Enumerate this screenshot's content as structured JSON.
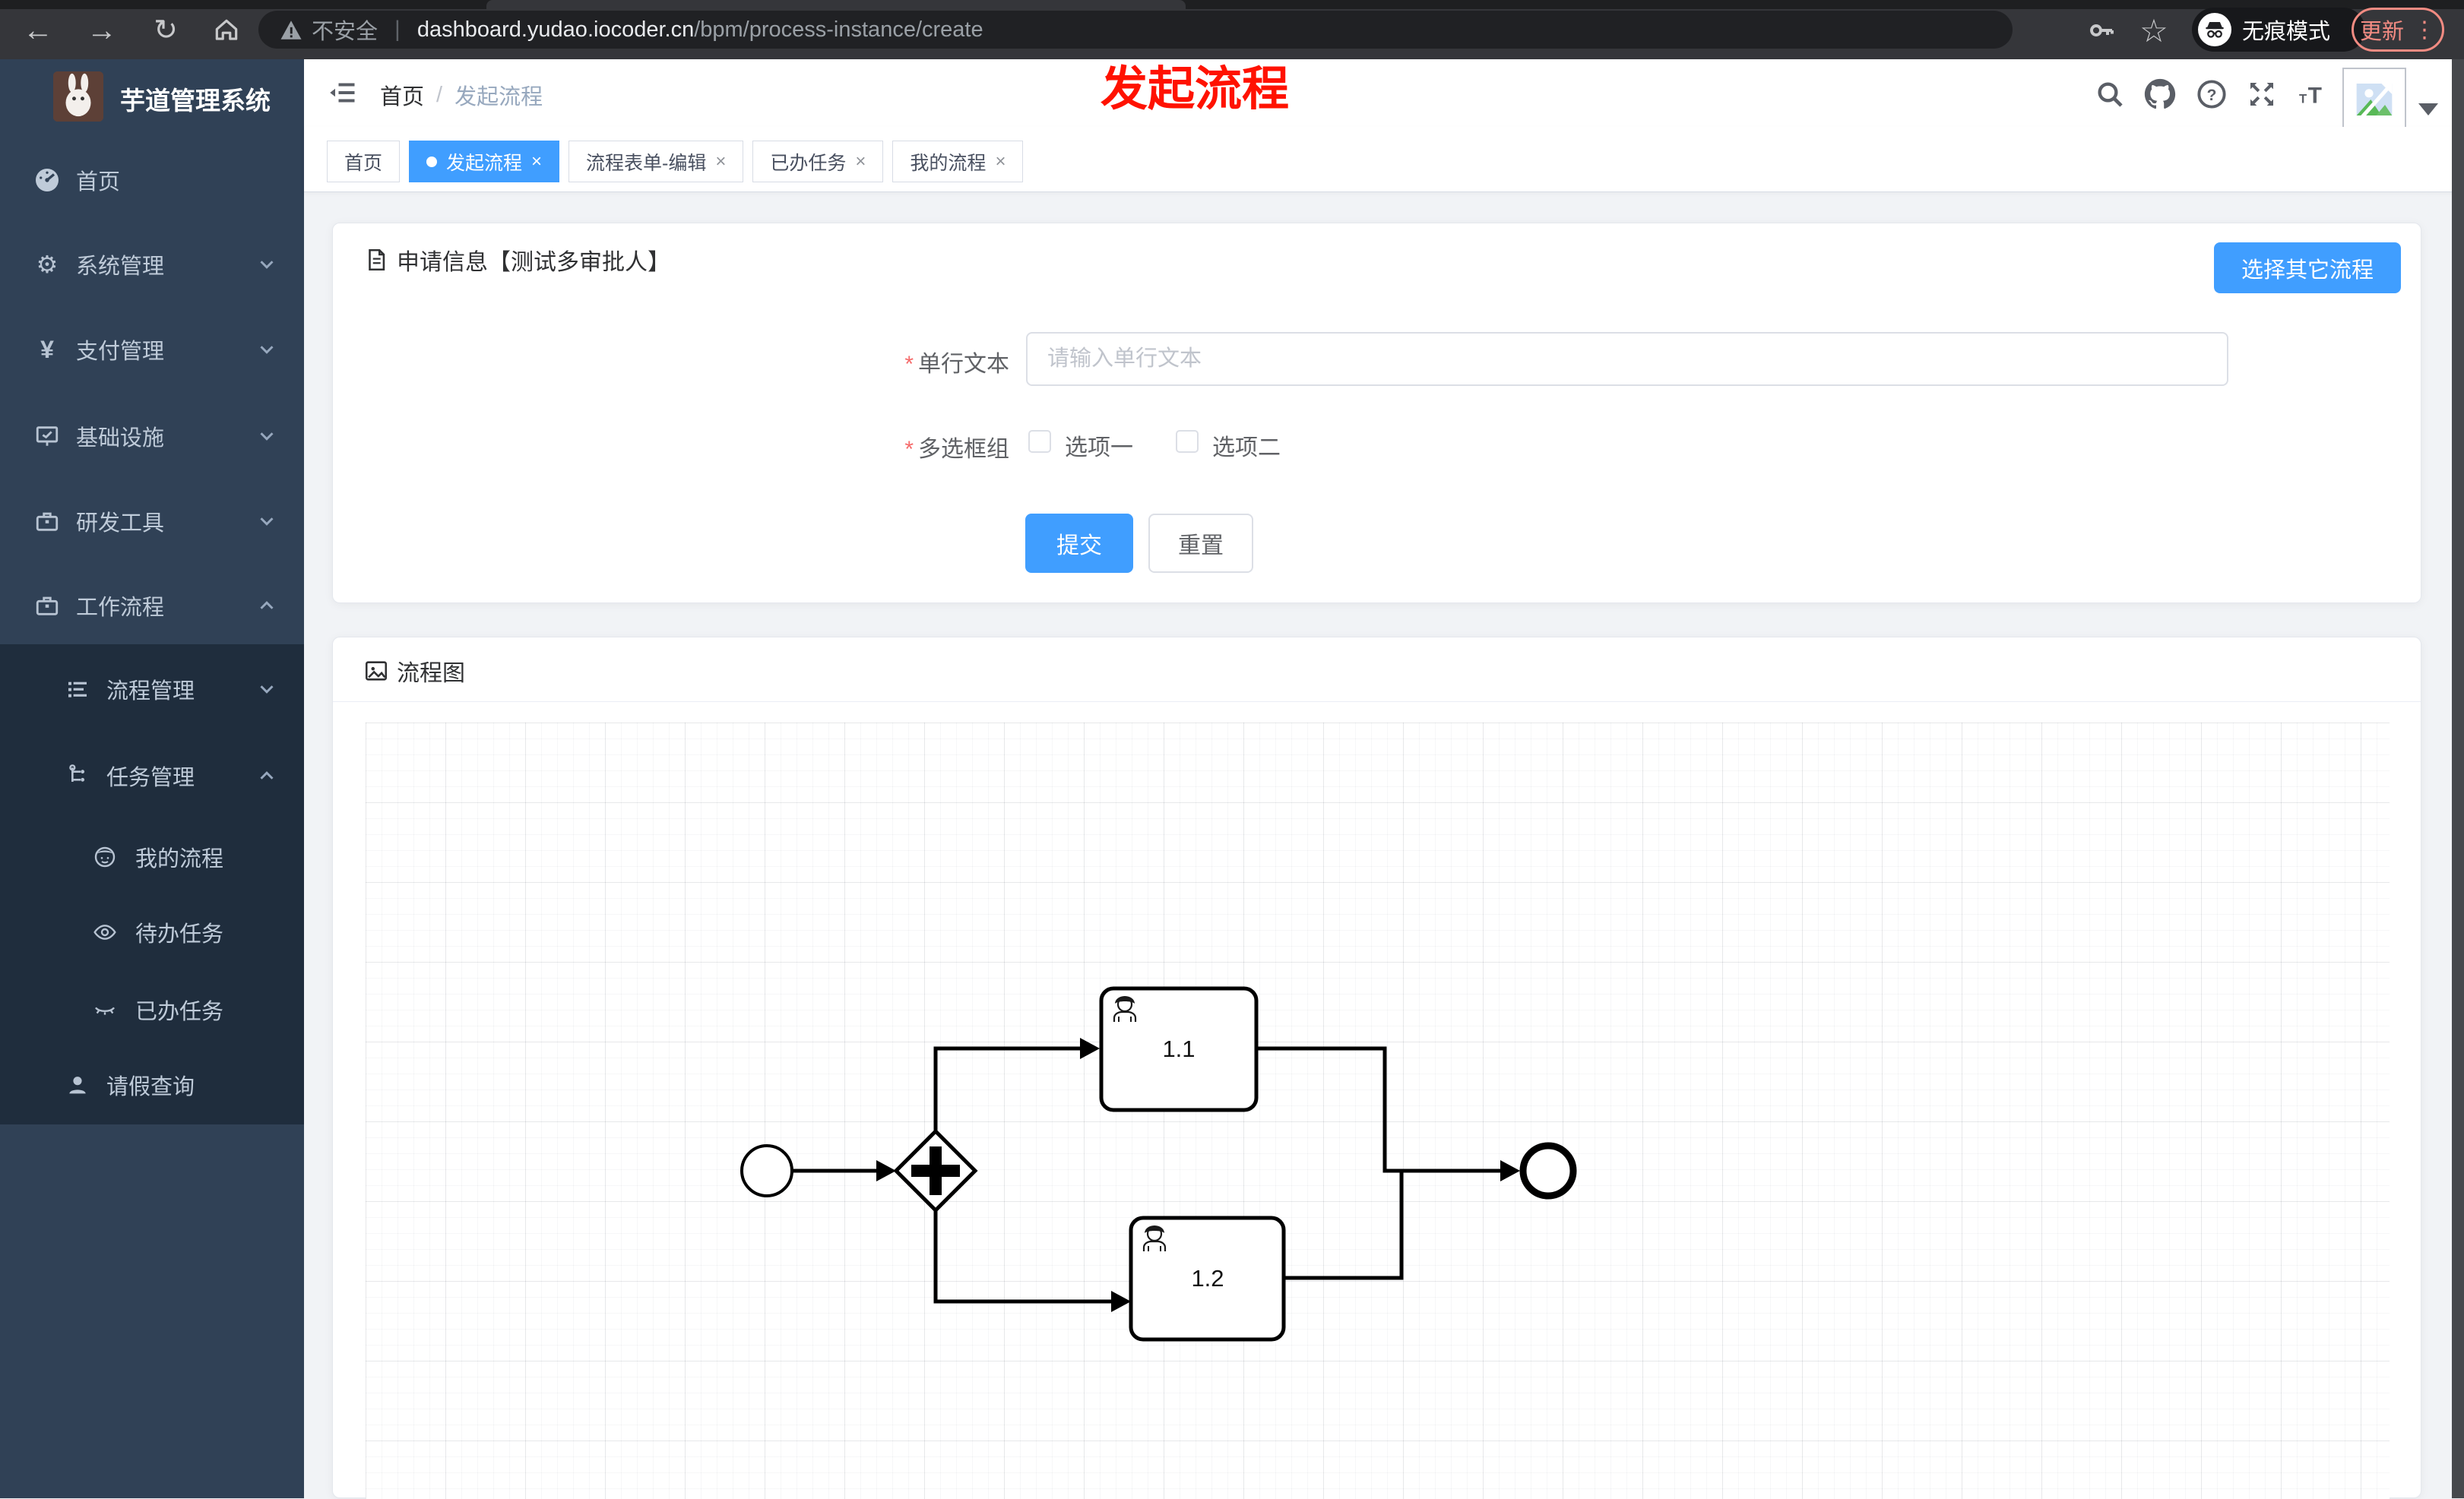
{
  "browser": {
    "security_label": "不安全",
    "url_host": "dashboard.yudao.iocoder.cn",
    "url_path": "/bpm/process-instance/create",
    "incognito_label": "无痕模式",
    "update_label": "更新",
    "menu_dots": "⋮"
  },
  "sidebar": {
    "title": "芋道管理系统",
    "items": [
      {
        "label": "首页"
      },
      {
        "label": "系统管理"
      },
      {
        "label": "支付管理"
      },
      {
        "label": "基础设施"
      },
      {
        "label": "研发工具"
      },
      {
        "label": "工作流程"
      },
      {
        "label": "流程管理"
      },
      {
        "label": "任务管理"
      },
      {
        "label": "我的流程"
      },
      {
        "label": "待办任务"
      },
      {
        "label": "已办任务"
      },
      {
        "label": "请假查询"
      }
    ]
  },
  "header": {
    "breadcrumb": {
      "home": "首页",
      "separator": "/",
      "current": "发起流程"
    },
    "annotation": "发起流程"
  },
  "tabs": {
    "close_symbol": "×",
    "items": [
      {
        "label": "首页"
      },
      {
        "label": "发起流程"
      },
      {
        "label": "流程表单-编辑"
      },
      {
        "label": "已办任务"
      },
      {
        "label": "我的流程"
      }
    ]
  },
  "form_card": {
    "title": "申请信息【测试多审批人】",
    "choose_button": "选择其它流程",
    "fields": {
      "text": {
        "label": "单行文本",
        "placeholder": "请输入单行文本",
        "value": ""
      },
      "checkbox_group": {
        "label": "多选框组",
        "options": [
          {
            "label": "选项一"
          },
          {
            "label": "选项二"
          }
        ]
      }
    },
    "submit_label": "提交",
    "reset_label": "重置"
  },
  "diagram_card": {
    "title": "流程图",
    "nodes": {
      "task1": "1.1",
      "task2": "1.2"
    }
  },
  "colors": {
    "primary": "#409eff",
    "sidebar_bg": "#304156",
    "submenu_bg": "#1f2d3d",
    "update_accent": "#f28b82",
    "annotation_red": "#ff1200"
  }
}
